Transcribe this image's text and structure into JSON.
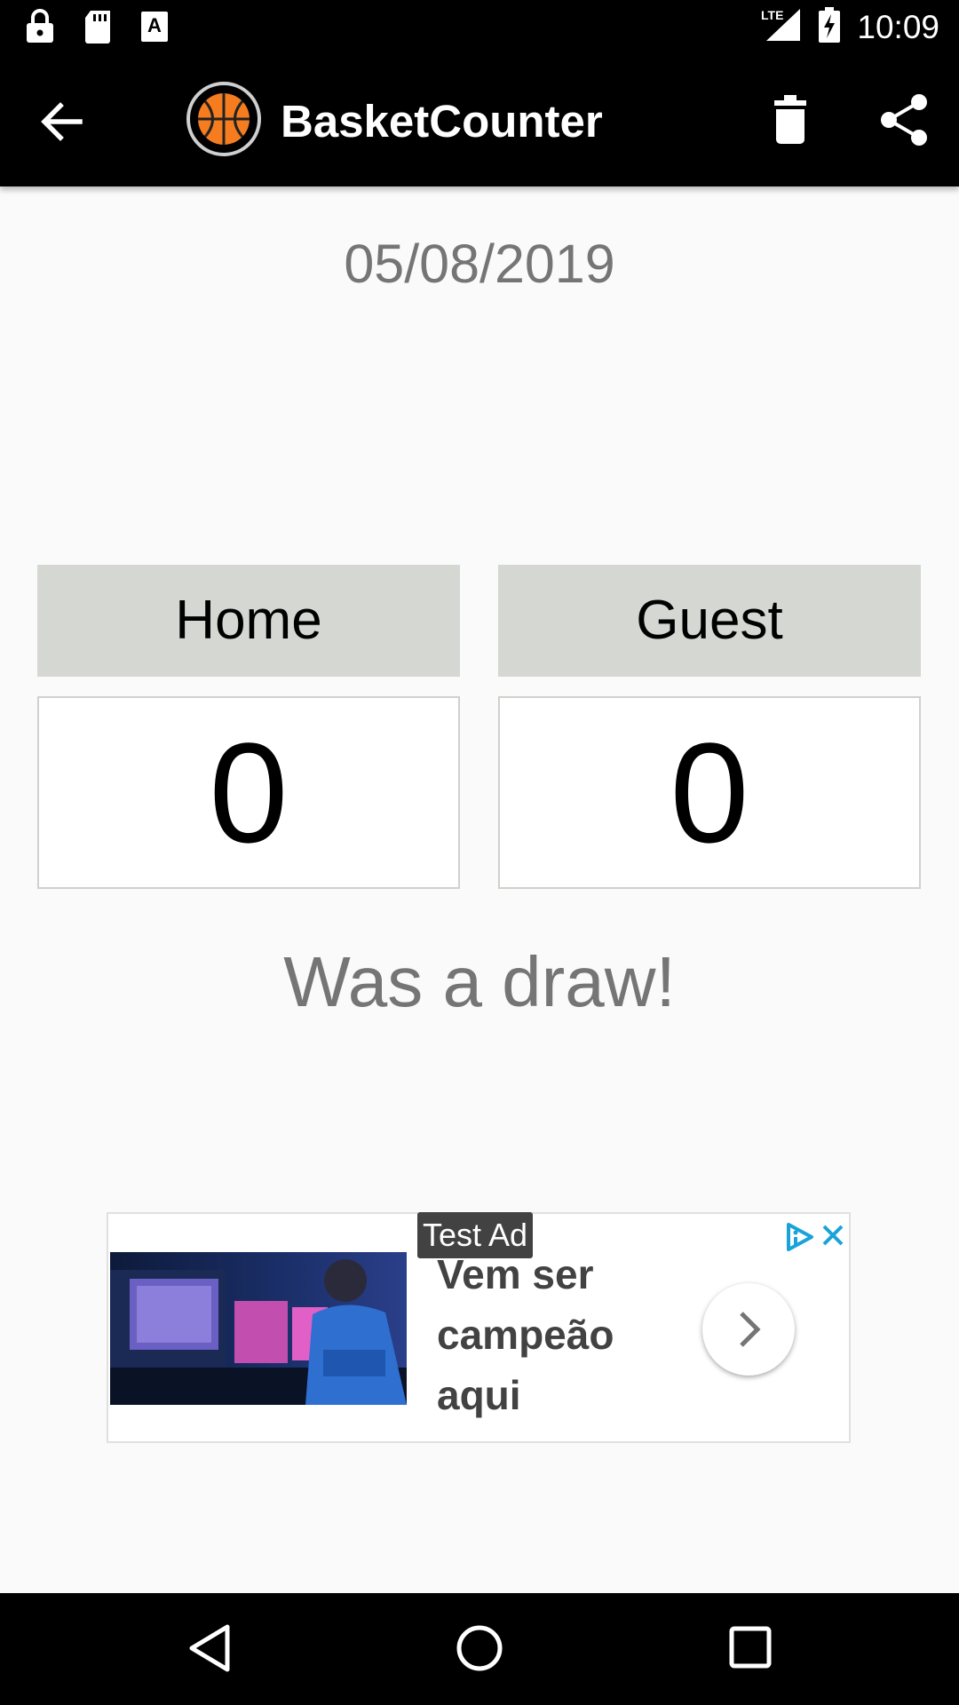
{
  "status_bar": {
    "time": "10:09",
    "network": "LTE"
  },
  "app_bar": {
    "title": "BasketCounter"
  },
  "game": {
    "date": "05/08/2019",
    "home": {
      "label": "Home",
      "score": "0"
    },
    "guest": {
      "label": "Guest",
      "score": "0"
    },
    "result": "Was a draw!"
  },
  "ad": {
    "badge": "Test Ad",
    "text": "Vem ser campeão aqui"
  },
  "colors": {
    "bars": "#000000",
    "background": "#fafafa",
    "team_header": "#d5d7d2",
    "muted_text": "#757575",
    "ball_orange": "#f57c1f"
  }
}
